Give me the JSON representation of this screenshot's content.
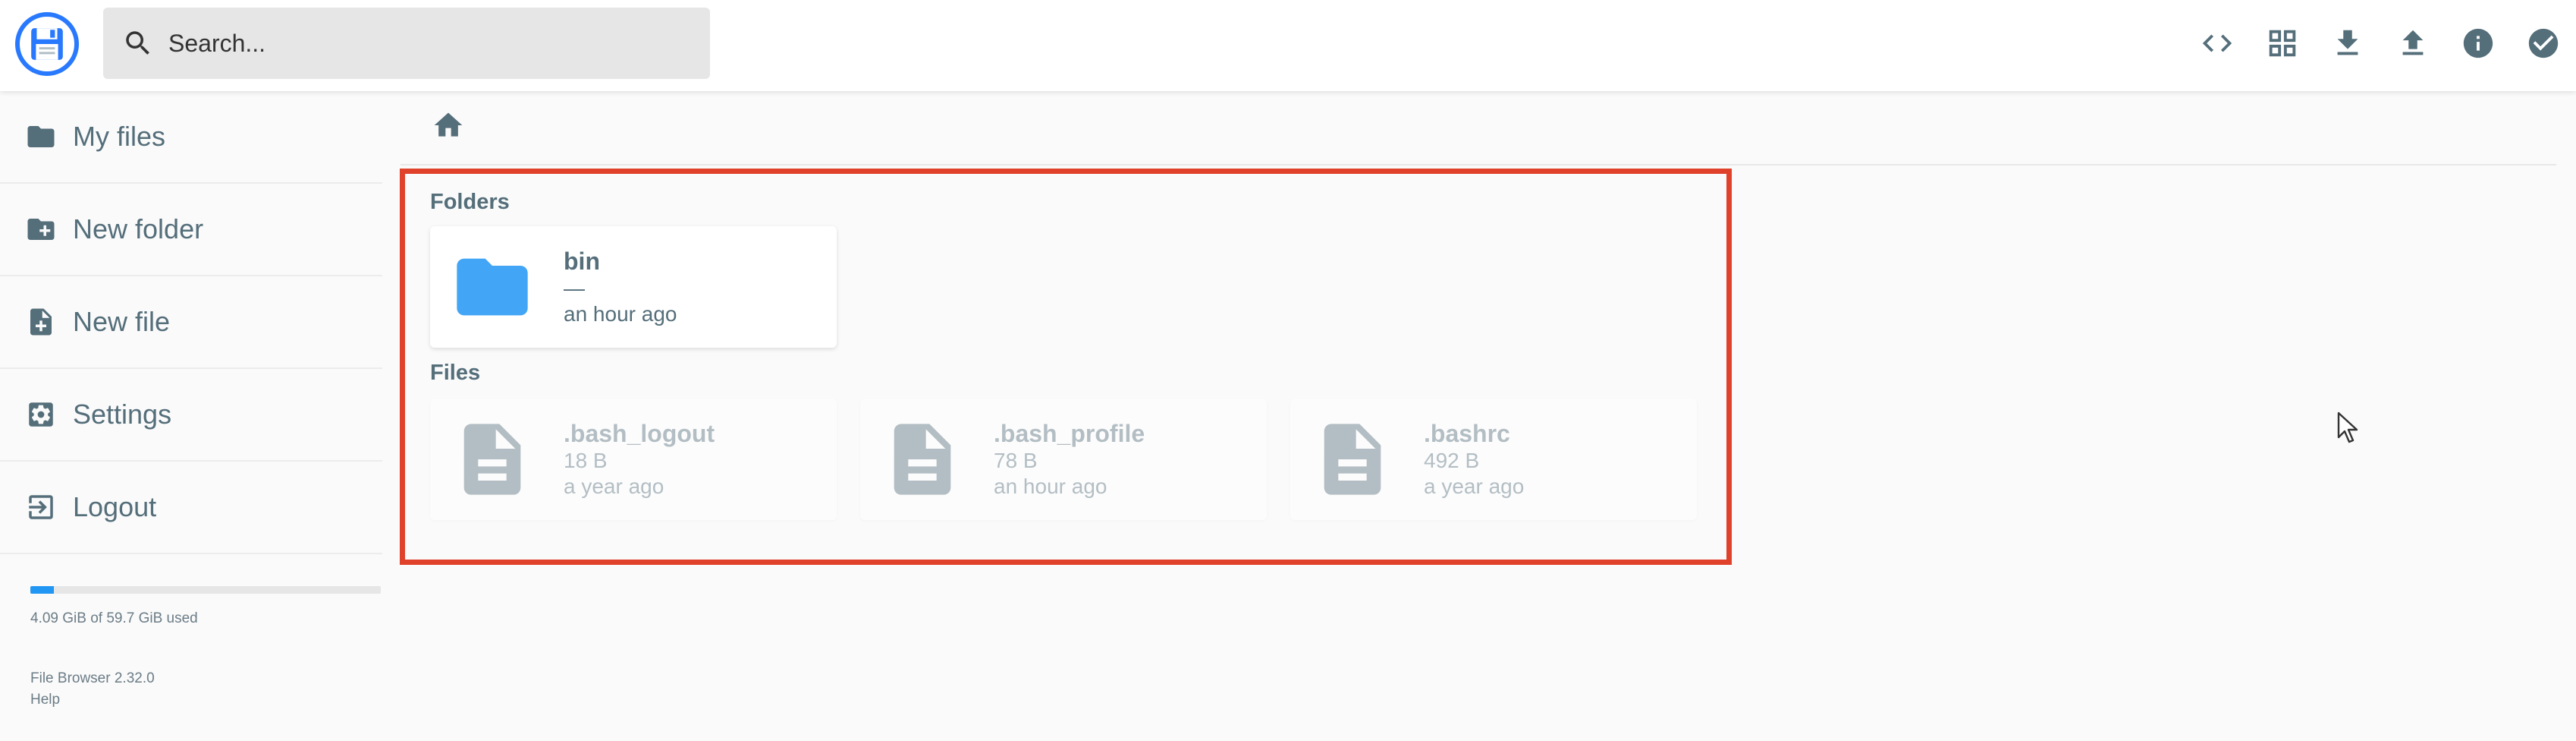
{
  "header": {
    "search_placeholder": "Search...",
    "actions": [
      {
        "name": "code-view-icon"
      },
      {
        "name": "grid-view-icon"
      },
      {
        "name": "download-icon"
      },
      {
        "name": "upload-icon"
      },
      {
        "name": "info-icon"
      },
      {
        "name": "check-circle-icon"
      }
    ]
  },
  "sidebar": {
    "items": [
      {
        "label": "My files",
        "icon": "folder-icon"
      },
      {
        "label": "New folder",
        "icon": "create-new-folder-icon"
      },
      {
        "label": "New file",
        "icon": "note-add-icon"
      },
      {
        "label": "Settings",
        "icon": "settings-icon"
      },
      {
        "label": "Logout",
        "icon": "logout-icon"
      }
    ],
    "usage": {
      "text": "4.09 GiB of 59.7 GiB used",
      "fraction": 0.068
    },
    "footer": {
      "version": "File Browser 2.32.0",
      "help": "Help"
    }
  },
  "main": {
    "folders_title": "Folders",
    "files_title": "Files",
    "folders": [
      {
        "name": "bin",
        "size": "—",
        "modified": "an hour ago"
      }
    ],
    "files": [
      {
        "name": ".bash_logout",
        "size": "18 B",
        "modified": "a year ago"
      },
      {
        "name": ".bash_profile",
        "size": "78 B",
        "modified": "an hour ago"
      },
      {
        "name": ".bashrc",
        "size": "492 B",
        "modified": "a year ago"
      }
    ]
  },
  "colors": {
    "accent": "#2979ff",
    "folder": "#42a5f5",
    "highlight": "#e0412b",
    "icon": "#546e7a"
  }
}
